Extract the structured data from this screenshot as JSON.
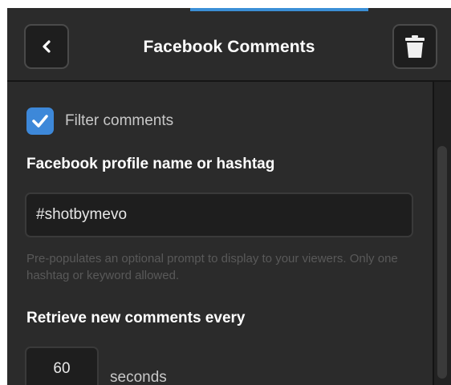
{
  "header": {
    "title": "Facebook Comments",
    "back_icon": "chevron-left-icon",
    "delete_icon": "trash-icon"
  },
  "filter": {
    "label": "Filter comments",
    "checked": true
  },
  "profile": {
    "heading": "Facebook profile name or hashtag",
    "value": "#shotbymevo",
    "help": "Pre-populates an optional prompt to display to your viewers. Only one hashtag or keyword allowed."
  },
  "retrieve": {
    "heading": "Retrieve new comments every",
    "value": "60",
    "unit": "seconds"
  },
  "colors": {
    "background": "#2b2b2b",
    "accent": "#3d88d9",
    "input_bg": "#1e1e1e"
  }
}
